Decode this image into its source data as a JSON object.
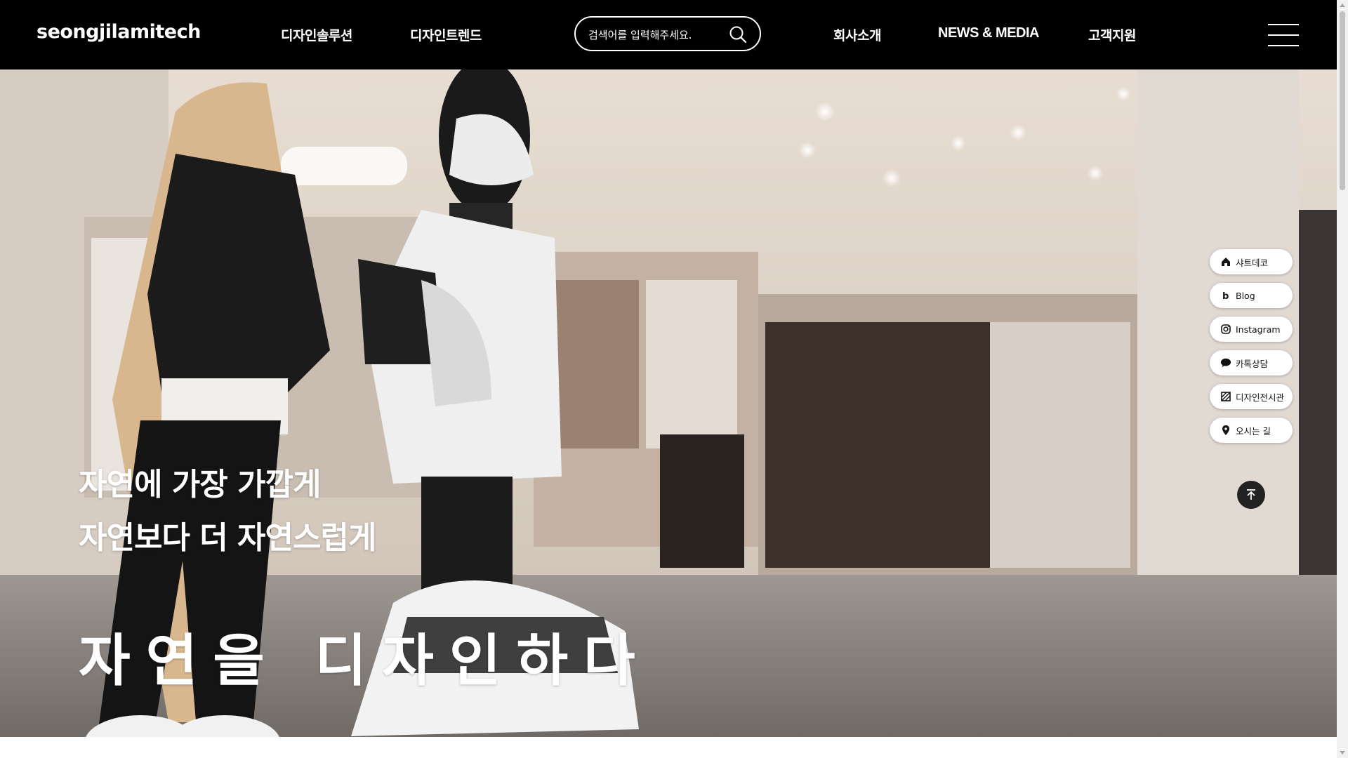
{
  "header": {
    "logo": "seongjilamitech",
    "nav_left": [
      "디자인솔루션",
      "디자인트렌드"
    ],
    "search_placeholder": "검색어를 입력해주세요.",
    "nav_right": [
      "회사소개",
      "NEWS & MEDIA",
      "고객지원"
    ]
  },
  "hero": {
    "line1": "자연에 가장 가깝게",
    "line2": "자연보다 더 자연스럽게",
    "line3": "자연을 디자인하다"
  },
  "quick_menu": [
    {
      "label": "샤트데코",
      "icon": "home-icon"
    },
    {
      "label": "Blog",
      "icon": "blog-b-icon"
    },
    {
      "label": "Instagram",
      "icon": "instagram-icon"
    },
    {
      "label": "카톡상담",
      "icon": "kakaotalk-icon"
    },
    {
      "label": "디자인전시관",
      "icon": "gallery-icon"
    },
    {
      "label": "오시는 길",
      "icon": "map-pin-icon"
    }
  ],
  "colors": {
    "header_bg": "#000000",
    "accent": "#ffffff"
  }
}
